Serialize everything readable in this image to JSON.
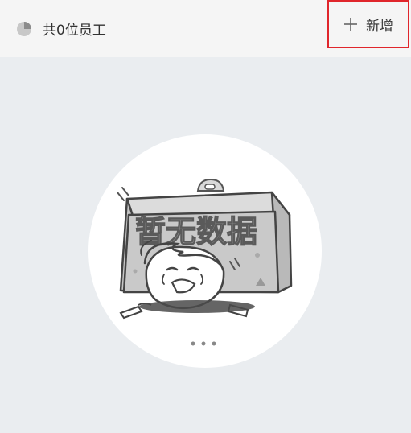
{
  "header": {
    "count_label": "共0位员工",
    "pie_icon": "pie-chart-icon",
    "add_button": {
      "label": "新增",
      "icon": "plus-icon",
      "highlight_color": "#e0262c"
    }
  },
  "empty_state": {
    "text": "暂无数据"
  }
}
